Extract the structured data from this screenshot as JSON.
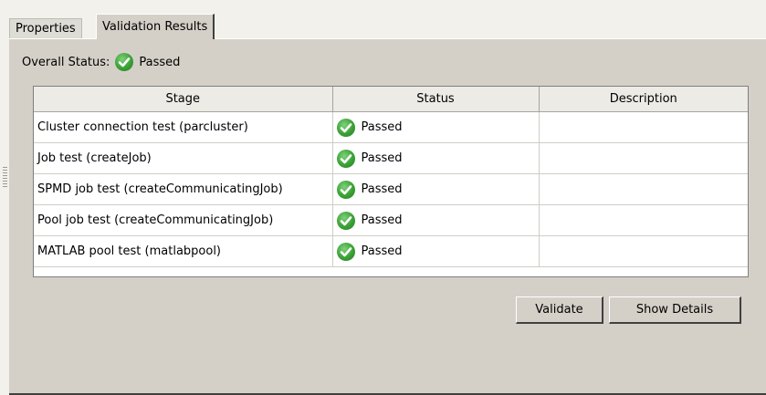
{
  "tabs": [
    {
      "label": "Properties"
    },
    {
      "label": "Validation Results"
    }
  ],
  "overall": {
    "label": "Overall Status:",
    "status": "Passed"
  },
  "table": {
    "headers": {
      "stage": "Stage",
      "status": "Status",
      "description": "Description"
    },
    "rows": [
      {
        "stage": "Cluster connection test (parcluster)",
        "status": "Passed",
        "description": ""
      },
      {
        "stage": "Job test (createJob)",
        "status": "Passed",
        "description": ""
      },
      {
        "stage": "SPMD job test (createCommunicatingJob)",
        "status": "Passed",
        "description": ""
      },
      {
        "stage": "Pool job test (createCommunicatingJob)",
        "status": "Passed",
        "description": ""
      },
      {
        "stage": "MATLAB pool test (matlabpool)",
        "status": "Passed",
        "description": ""
      }
    ]
  },
  "buttons": {
    "validate": "Validate",
    "show_details": "Show Details"
  },
  "icons": {
    "status_passed": "green-check-circle-icon"
  },
  "colors": {
    "panel_bg": "#d4d0c8",
    "passed_green": "#3aa035"
  }
}
